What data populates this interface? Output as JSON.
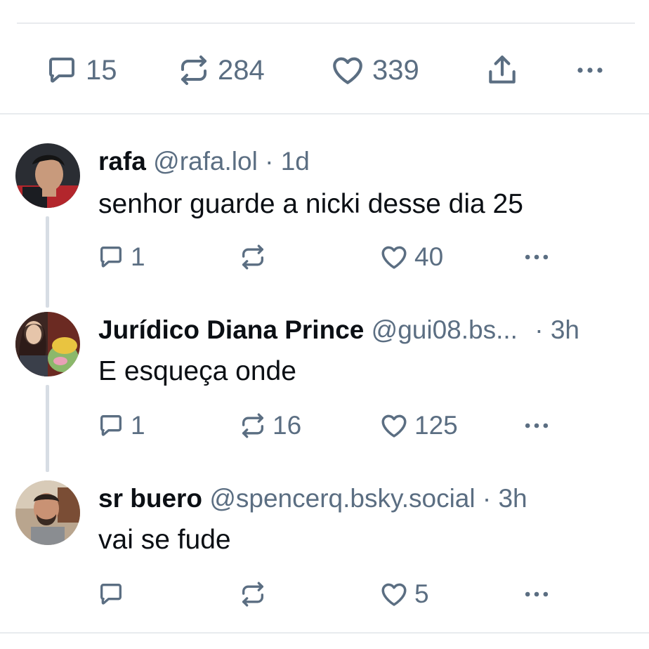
{
  "main_post": {
    "actions": {
      "replies": "15",
      "reposts": "284",
      "likes": "339"
    }
  },
  "replies": [
    {
      "name": "rafa",
      "handle": "@rafa.lol",
      "separator": "·",
      "time": "1d",
      "text": "senhor guarde a nicki desse dia 25",
      "replies": "1",
      "reposts": "",
      "likes": "40"
    },
    {
      "name": "Jurídico Diana Prince",
      "handle": "@gui08.bs...",
      "separator": "·",
      "time": "3h",
      "text": "E esqueça onde",
      "replies": "1",
      "reposts": "16",
      "likes": "125"
    },
    {
      "name": "sr buero",
      "handle": "@spencerq.bsky.social",
      "separator": "·",
      "time": "3h",
      "text": "vai se fude",
      "replies": "",
      "reposts": "",
      "likes": "5"
    }
  ],
  "colors": {
    "text": "#0b0f14",
    "muted": "#5b6e82",
    "divider": "#e8ebee",
    "thread_line": "#d7dde4"
  },
  "icons": [
    "reply-icon",
    "repost-icon",
    "like-icon",
    "share-icon",
    "more-icon"
  ]
}
